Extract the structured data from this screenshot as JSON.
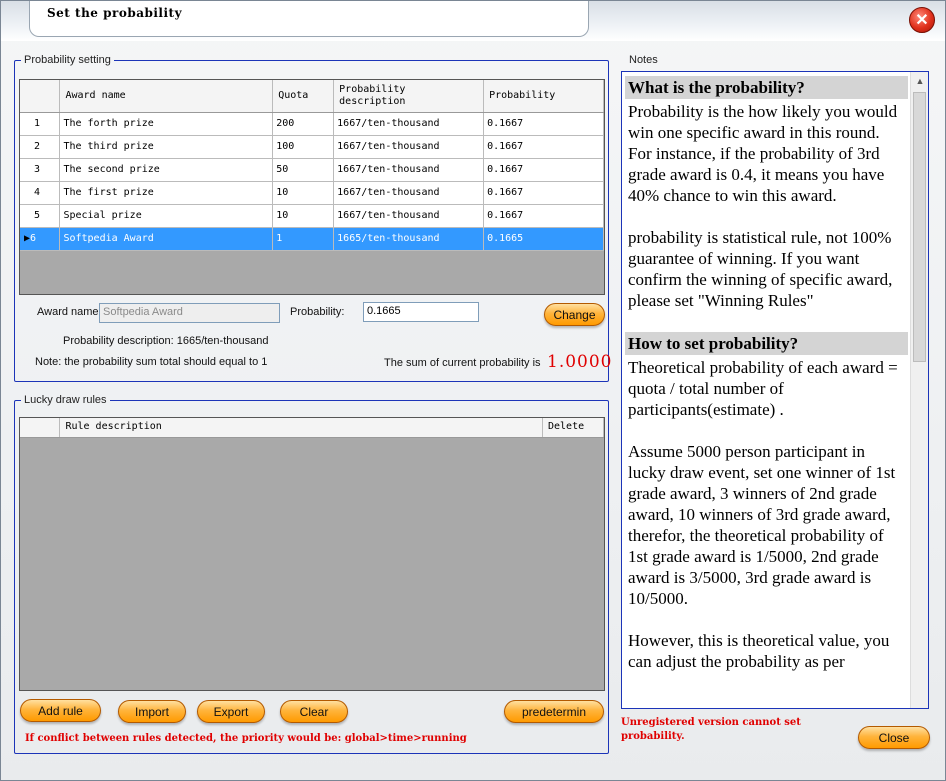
{
  "window": {
    "title": "Set the probability"
  },
  "probability_setting": {
    "legend": "Probability setting",
    "columns": [
      "Award name",
      "Quota",
      "Probability\ndescription",
      "Probability"
    ],
    "rows": [
      {
        "index": "1",
        "award": "The forth prize",
        "quota": "200",
        "description": "1667/ten-thousand",
        "probability": "0.1667"
      },
      {
        "index": "2",
        "award": "The third prize",
        "quota": "100",
        "description": "1667/ten-thousand",
        "probability": "0.1667"
      },
      {
        "index": "3",
        "award": "The second prize",
        "quota": "50",
        "description": "1667/ten-thousand",
        "probability": "0.1667"
      },
      {
        "index": "4",
        "award": "The first prize",
        "quota": "10",
        "description": "1667/ten-thousand",
        "probability": "0.1667"
      },
      {
        "index": "5",
        "award": "Special prize",
        "quota": "10",
        "description": "1667/ten-thousand",
        "probability": "0.1667"
      },
      {
        "index": "6",
        "award": "Softpedia Award",
        "quota": "1",
        "description": "1665/ten-thousand",
        "probability": "0.1665",
        "selected": true
      }
    ],
    "award_name_label": "Award name",
    "award_name_value": "Softpedia Award",
    "probability_label": "Probability:",
    "probability_value": "0.1665",
    "change_button": "Change",
    "description_text": "Probability description: 1665/ten-thousand",
    "note_text": "Note: the probability sum total should equal to 1",
    "sum_label": "The sum of current probability is",
    "sum_value": "1.0000"
  },
  "lucky_draw": {
    "legend": "Lucky draw rules",
    "columns": [
      "Rule description",
      "Delete"
    ],
    "buttons": {
      "add_rule": "Add rule",
      "import": "Import",
      "export": "Export",
      "clear": "Clear",
      "predetermine": "predetermin"
    },
    "conflict_note": "If conflict between rules detected, the priority would be: global>time>running"
  },
  "notes": {
    "legend": "Notes",
    "heading1": "What is the probability?",
    "para1": "Probability is the how likely you would win one specific award in this round. For instance, if the probability of 3rd grade award is 0.4, it means you have 40% chance to win this award.",
    "para2": "probability is statistical rule, not 100% guarantee of winning. If you want confirm the winning of specific award, please set \"Winning Rules\"",
    "heading2": "How to set probability?",
    "para3": "Theoretical probability of each award = quota / total number of participants(estimate) .",
    "para4": "Assume 5000 person participant in lucky draw event, set one winner of 1st grade award, 3 winners of 2nd grade award, 10 winners of 3rd grade award, therefor, the theoretical probability of 1st grade award is 1/5000, 2nd grade award is 3/5000, 3rd grade award is 10/5000.",
    "para5": "However, this is theoretical value, you can adjust the probability as per"
  },
  "footer": {
    "unregistered_line1": "Unregistered version cannot set",
    "unregistered_line2": "probability.",
    "close_button": "Close"
  },
  "colors": {
    "accent_blue": "#1c34b8",
    "selection": "#3399ff",
    "button_orange": "#ff9a00",
    "warning_red": "#e00000"
  }
}
